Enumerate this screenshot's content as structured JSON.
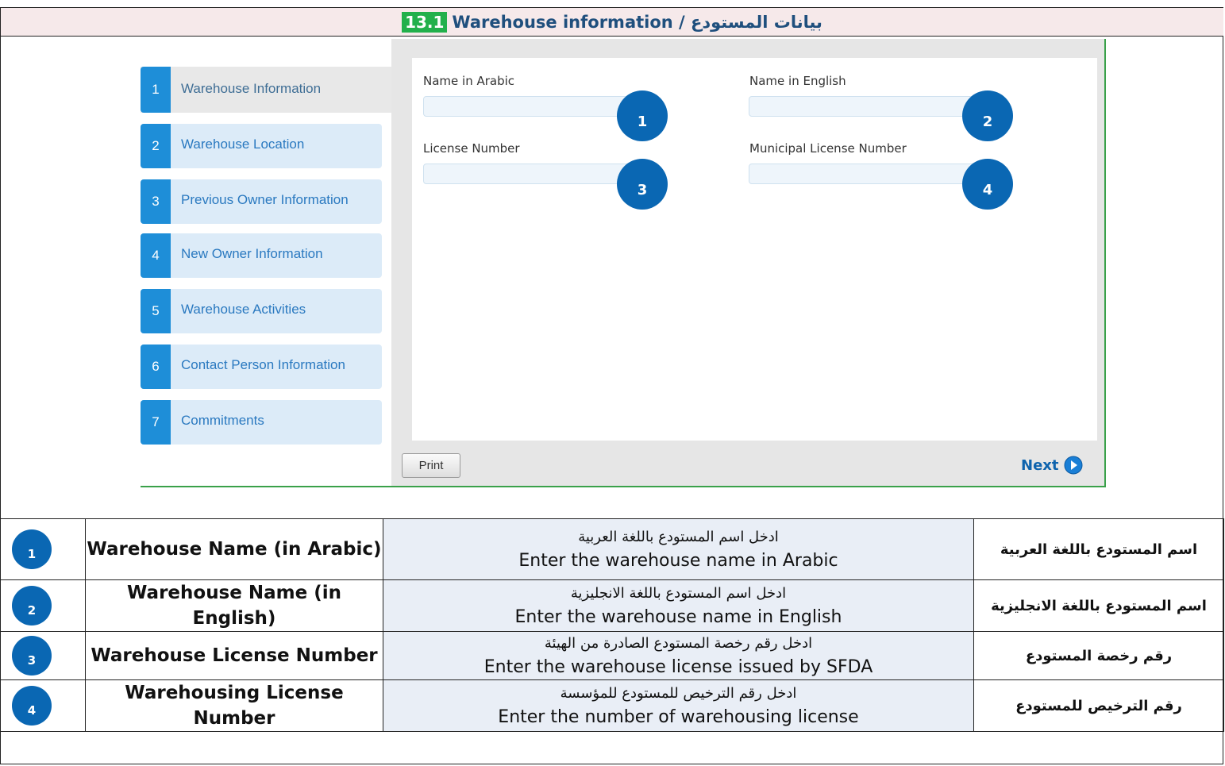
{
  "title": {
    "number": "13.1",
    "text": "Warehouse information / بيانات المستودع"
  },
  "steps": [
    {
      "num": "1",
      "label": "Warehouse Information",
      "active": true
    },
    {
      "num": "2",
      "label": "Warehouse Location"
    },
    {
      "num": "3",
      "label": "Previous Owner Information"
    },
    {
      "num": "4",
      "label": "New Owner Information"
    },
    {
      "num": "5",
      "label": "Warehouse Activities"
    },
    {
      "num": "6",
      "label": "Contact Person Information"
    },
    {
      "num": "7",
      "label": "Commitments"
    }
  ],
  "form": {
    "name_ar_label": "Name in Arabic",
    "name_en_label": "Name in English",
    "license_label": "License Number",
    "municipal_label": "Municipal License Number",
    "markers": [
      "1",
      "2",
      "3",
      "4"
    ]
  },
  "buttons": {
    "print": "Print",
    "next": "Next"
  },
  "table": [
    {
      "num": "1",
      "en": "Warehouse Name (in Arabic)",
      "desc_ar": "ادخل اسم المستودع  باللغة العربية",
      "desc_en": "Enter the warehouse name in Arabic",
      "ar": "اسم المستودع  باللغة العربية"
    },
    {
      "num": "2",
      "en": "Warehouse Name (in English)",
      "desc_ar": "ادخل اسم المستودع باللغة الانجليزية",
      "desc_en": "Enter the warehouse name in English",
      "ar": "اسم المستودع  باللغة الانجليزية"
    },
    {
      "num": "3",
      "en": "Warehouse License Number",
      "desc_ar": "ادخل رقم رخصة المستودع الصادرة من الهيئة",
      "desc_en": "Enter the warehouse license issued by SFDA",
      "ar": "رقم رخصة المستودع"
    },
    {
      "num": "4",
      "en": "Warehousing License Number",
      "desc_ar": "ادخل رقم الترخيص للمستودع للمؤسسة",
      "desc_en": "Enter the number of warehousing license",
      "ar": "رقم الترخيص للمستودع"
    }
  ],
  "colors": {
    "step_blue": "#1e8ed8",
    "marker_blue": "#0a67b3",
    "title_green": "#22b04b",
    "title_text": "#1f4f7d"
  }
}
